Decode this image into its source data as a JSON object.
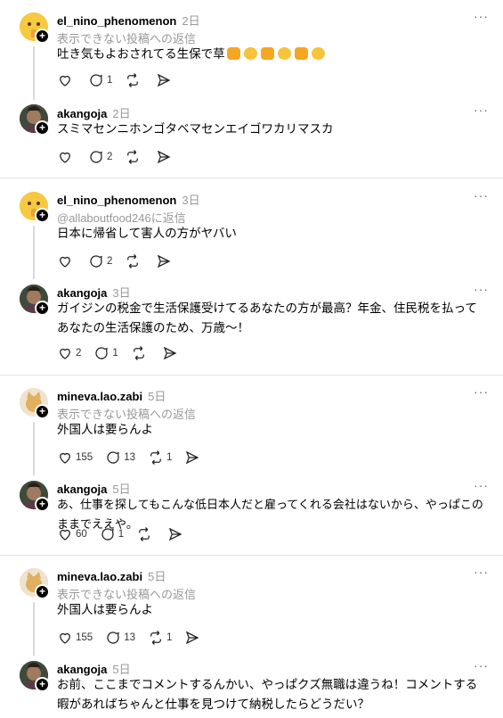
{
  "threads": [
    {
      "parent": {
        "username": "el_nino_phenomenon",
        "time": "2日",
        "sub": "表示できない投稿への返信",
        "text": "吐き気もよおされてる生保で草",
        "emojis": [
          "fist",
          "laugh",
          "fist",
          "laugh",
          "fist",
          "laugh"
        ],
        "likes": "",
        "comments": "1",
        "reposts": ""
      },
      "reply": {
        "username": "akangoja",
        "time": "2日",
        "text": "スミマセンニホンゴタベマセンエイゴワカリマスカ",
        "likes": "",
        "comments": "2",
        "reposts": ""
      }
    },
    {
      "parent": {
        "username": "el_nino_phenomenon",
        "time": "3日",
        "sub": "@allaboutfood246に返信",
        "text": "日本に帰省して害人の方がヤバい",
        "likes": "",
        "comments": "2",
        "reposts": ""
      },
      "reply": {
        "username": "akangoja",
        "time": "3日",
        "text": "ガイジンの税金で生活保護受けてるあなたの方が最高？年金、住民税を払ってあなたの生活保護のため、万歳〜！",
        "likes": "2",
        "comments": "1",
        "reposts": ""
      }
    },
    {
      "parent": {
        "username": "mineva.lao.zabi",
        "time": "5日",
        "sub": "表示できない投稿への返信",
        "text": "外国人は要らんよ",
        "likes": "155",
        "comments": "13",
        "reposts": "1"
      },
      "reply": {
        "username": "akangoja",
        "time": "5日",
        "text": "あ、仕事を探してもこんな低日本人だと雇ってくれる会社はないから、やっぱこのままでええや。",
        "likes": "60",
        "comments": "1",
        "reposts": ""
      }
    },
    {
      "parent": {
        "username": "mineva.lao.zabi",
        "time": "5日",
        "sub": "表示できない投稿への返信",
        "text": "外国人は要らんよ",
        "likes": "155",
        "comments": "13",
        "reposts": "1"
      },
      "reply": {
        "username": "akangoja",
        "time": "5日",
        "text": "お前、ここまでコメントするんかい、やっぱクズ無職は違うね！コメントする暇があればちゃんと仕事を見つけて納税したらどうだい？",
        "likes": "",
        "comments": "",
        "reposts": ""
      }
    }
  ],
  "more_label": "···",
  "icons": [
    "heart-icon",
    "comment-icon",
    "repost-icon",
    "share-icon",
    "more-icon",
    "follow-plus-icon"
  ]
}
